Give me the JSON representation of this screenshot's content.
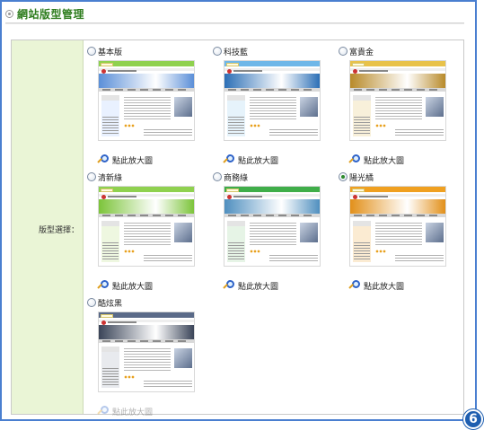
{
  "header": {
    "title": "網站版型管理"
  },
  "form": {
    "field_label": "版型選擇："
  },
  "zoom_label": "點此放大圖",
  "templates": [
    {
      "name": "基本版",
      "selected": false,
      "colors": {
        "top": "#8fd14f",
        "banner": "#5b8fd8",
        "side": "#e9f1ff"
      }
    },
    {
      "name": "科技藍",
      "selected": false,
      "colors": {
        "top": "#6fb7e8",
        "banner": "#2c6fb6",
        "side": "#e6f3fb"
      }
    },
    {
      "name": "富貴金",
      "selected": false,
      "colors": {
        "top": "#e8c24a",
        "banner": "#b88a2a",
        "side": "#f8f0da"
      }
    },
    {
      "name": "清新綠",
      "selected": false,
      "colors": {
        "top": "#8fd14f",
        "banner": "#7cc43a",
        "side": "#eef7e0"
      }
    },
    {
      "name": "商務綠",
      "selected": false,
      "colors": {
        "top": "#3fae49",
        "banner": "#4f8fbf",
        "side": "#e6f4e6"
      }
    },
    {
      "name": "陽光橘",
      "selected": true,
      "colors": {
        "top": "#f0a020",
        "banner": "#e2901a",
        "side": "#fbebd2"
      }
    },
    {
      "name": "酷炫黑",
      "selected": false,
      "colors": {
        "top": "#5a6a88",
        "banner": "#3a4458",
        "side": "#e8eaee"
      }
    }
  ],
  "step_badge": "6"
}
